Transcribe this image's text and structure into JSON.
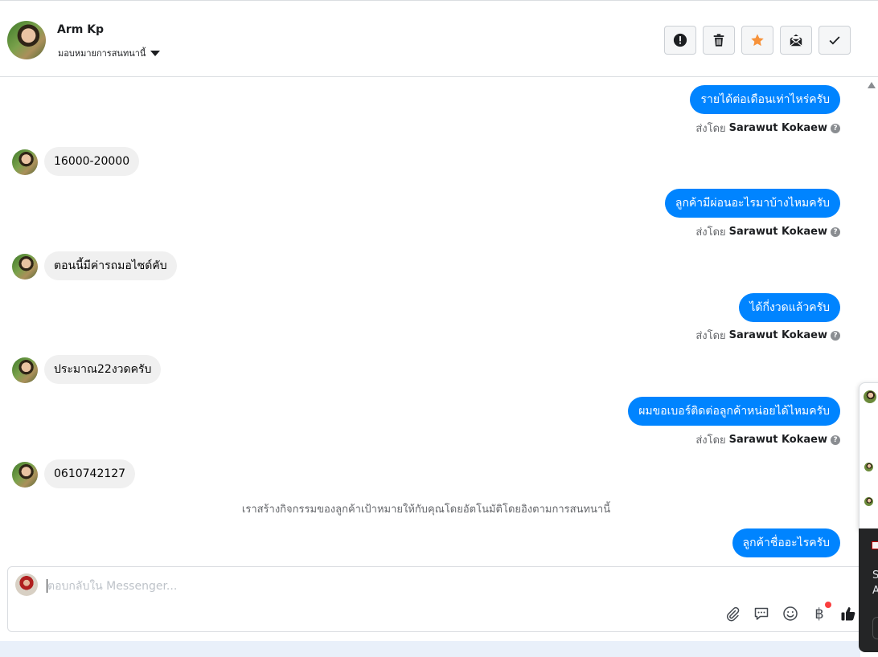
{
  "header": {
    "name": "Arm Kp",
    "assign_label": "มอบหมายการสนทนานี้",
    "actions": [
      {
        "id": "spam",
        "icon": "alert-icon"
      },
      {
        "id": "delete",
        "icon": "trash-icon"
      },
      {
        "id": "star",
        "icon": "star-icon"
      },
      {
        "id": "mark-unread",
        "icon": "envelope-icon"
      },
      {
        "id": "done",
        "icon": "check-icon"
      }
    ]
  },
  "messages": [
    {
      "dir": "out",
      "text": "รายได้ต่อเดือนเท่าไหร่ครับ",
      "sent_prefix": "ส่งโดย",
      "sender": "Sarawut Kokaew"
    },
    {
      "dir": "in",
      "text": "16000-20000"
    },
    {
      "dir": "out",
      "text": "ลูกค้ามีผ่อนอะไรมาบ้างไหมครับ",
      "sent_prefix": "ส่งโดย",
      "sender": "Sarawut Kokaew"
    },
    {
      "dir": "in",
      "text": "ตอนนี้มีค่ารถมอไซด์คับ"
    },
    {
      "dir": "out",
      "text": "ได้กี่งวดแล้วครับ",
      "sent_prefix": "ส่งโดย",
      "sender": "Sarawut Kokaew"
    },
    {
      "dir": "in",
      "text": "ประมาณ22งวดครับ"
    },
    {
      "dir": "out",
      "text": "ผมขอเบอร์ติดต่อลูกค้าหน่อยได้ไหมครับ",
      "sent_prefix": "ส่งโดย",
      "sender": "Sarawut Kokaew"
    },
    {
      "dir": "in",
      "text": "0610742127"
    },
    {
      "dir": "out",
      "text": "ลูกค้าชื่ออะไรครับ"
    }
  ],
  "system_note": "เราสร้างกิจกรรมของลูกค้าเป้าหมายให้กับคุณโดยอัตโนมัติโดยอิงตามการสนทนานี้",
  "composer": {
    "placeholder": "ตอบกลับใน Messenger...",
    "currency_symbol": "฿"
  },
  "side_popup": {
    "line1": "S",
    "line2": "A"
  },
  "colors": {
    "outgoing_bubble": "#0084ff",
    "incoming_bubble": "#f0f0f0",
    "star": "#f7923a"
  }
}
